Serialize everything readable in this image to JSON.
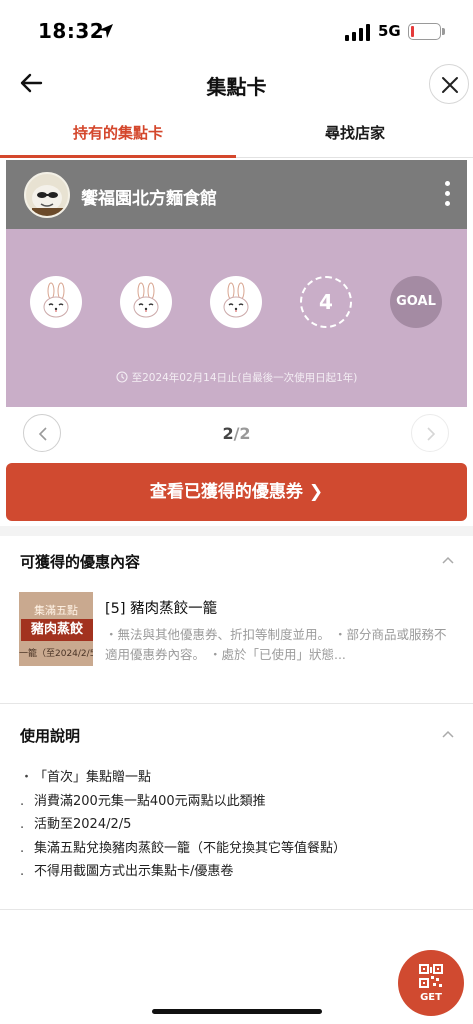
{
  "status_bar": {
    "time": "18:32",
    "network": "5G"
  },
  "nav": {
    "title": "集點卡"
  },
  "tabs": [
    {
      "label": "持有的集點卡",
      "active": true
    },
    {
      "label": "尋找店家",
      "active": false
    }
  ],
  "card": {
    "store_name": "饗福園北方麵食館",
    "stamps_collected": 3,
    "next_stamp": "4",
    "goal_label": "GOAL",
    "validity": "至2024年02月14日止(自最後一次使用日起1年)",
    "header_color": "#7b7b7b",
    "body_color": "#c9aec8"
  },
  "pager": {
    "current": "2",
    "separator": "/",
    "total": "2"
  },
  "cta": {
    "label": "查看已獲得的優惠券 ❯",
    "color": "#d04a30"
  },
  "benefits": {
    "title": "可獲得的優惠內容",
    "coupon": {
      "image_top": "集滿五點",
      "image_main": "豬肉蒸餃",
      "image_bottom": "一籠（至2024/2/5",
      "title": "[5] 豬肉蒸餃一籠",
      "description": "・無法與其他優惠券、折扣等制度並用。 ・部分商品或服務不適用優惠券內容。 ・處於「已使用」狀態..."
    }
  },
  "instructions": {
    "title": "使用說明",
    "items": [
      {
        "bullet": "・",
        "text": "「首次」集點贈一點"
      },
      {
        "bullet": ".",
        "text": "消費滿200元集一點400元兩點以此類推"
      },
      {
        "bullet": ".",
        "text": "活動至2024/2/5"
      },
      {
        "bullet": ".",
        "text": "集滿五點兌換豬肉蒸餃一籠（不能兌換其它等值餐點）"
      },
      {
        "bullet": ".",
        "text": "不得用截圖方式出示集點卡/優惠卷"
      }
    ]
  },
  "fab": {
    "label": "GET"
  },
  "accent_color": "#d4472c"
}
